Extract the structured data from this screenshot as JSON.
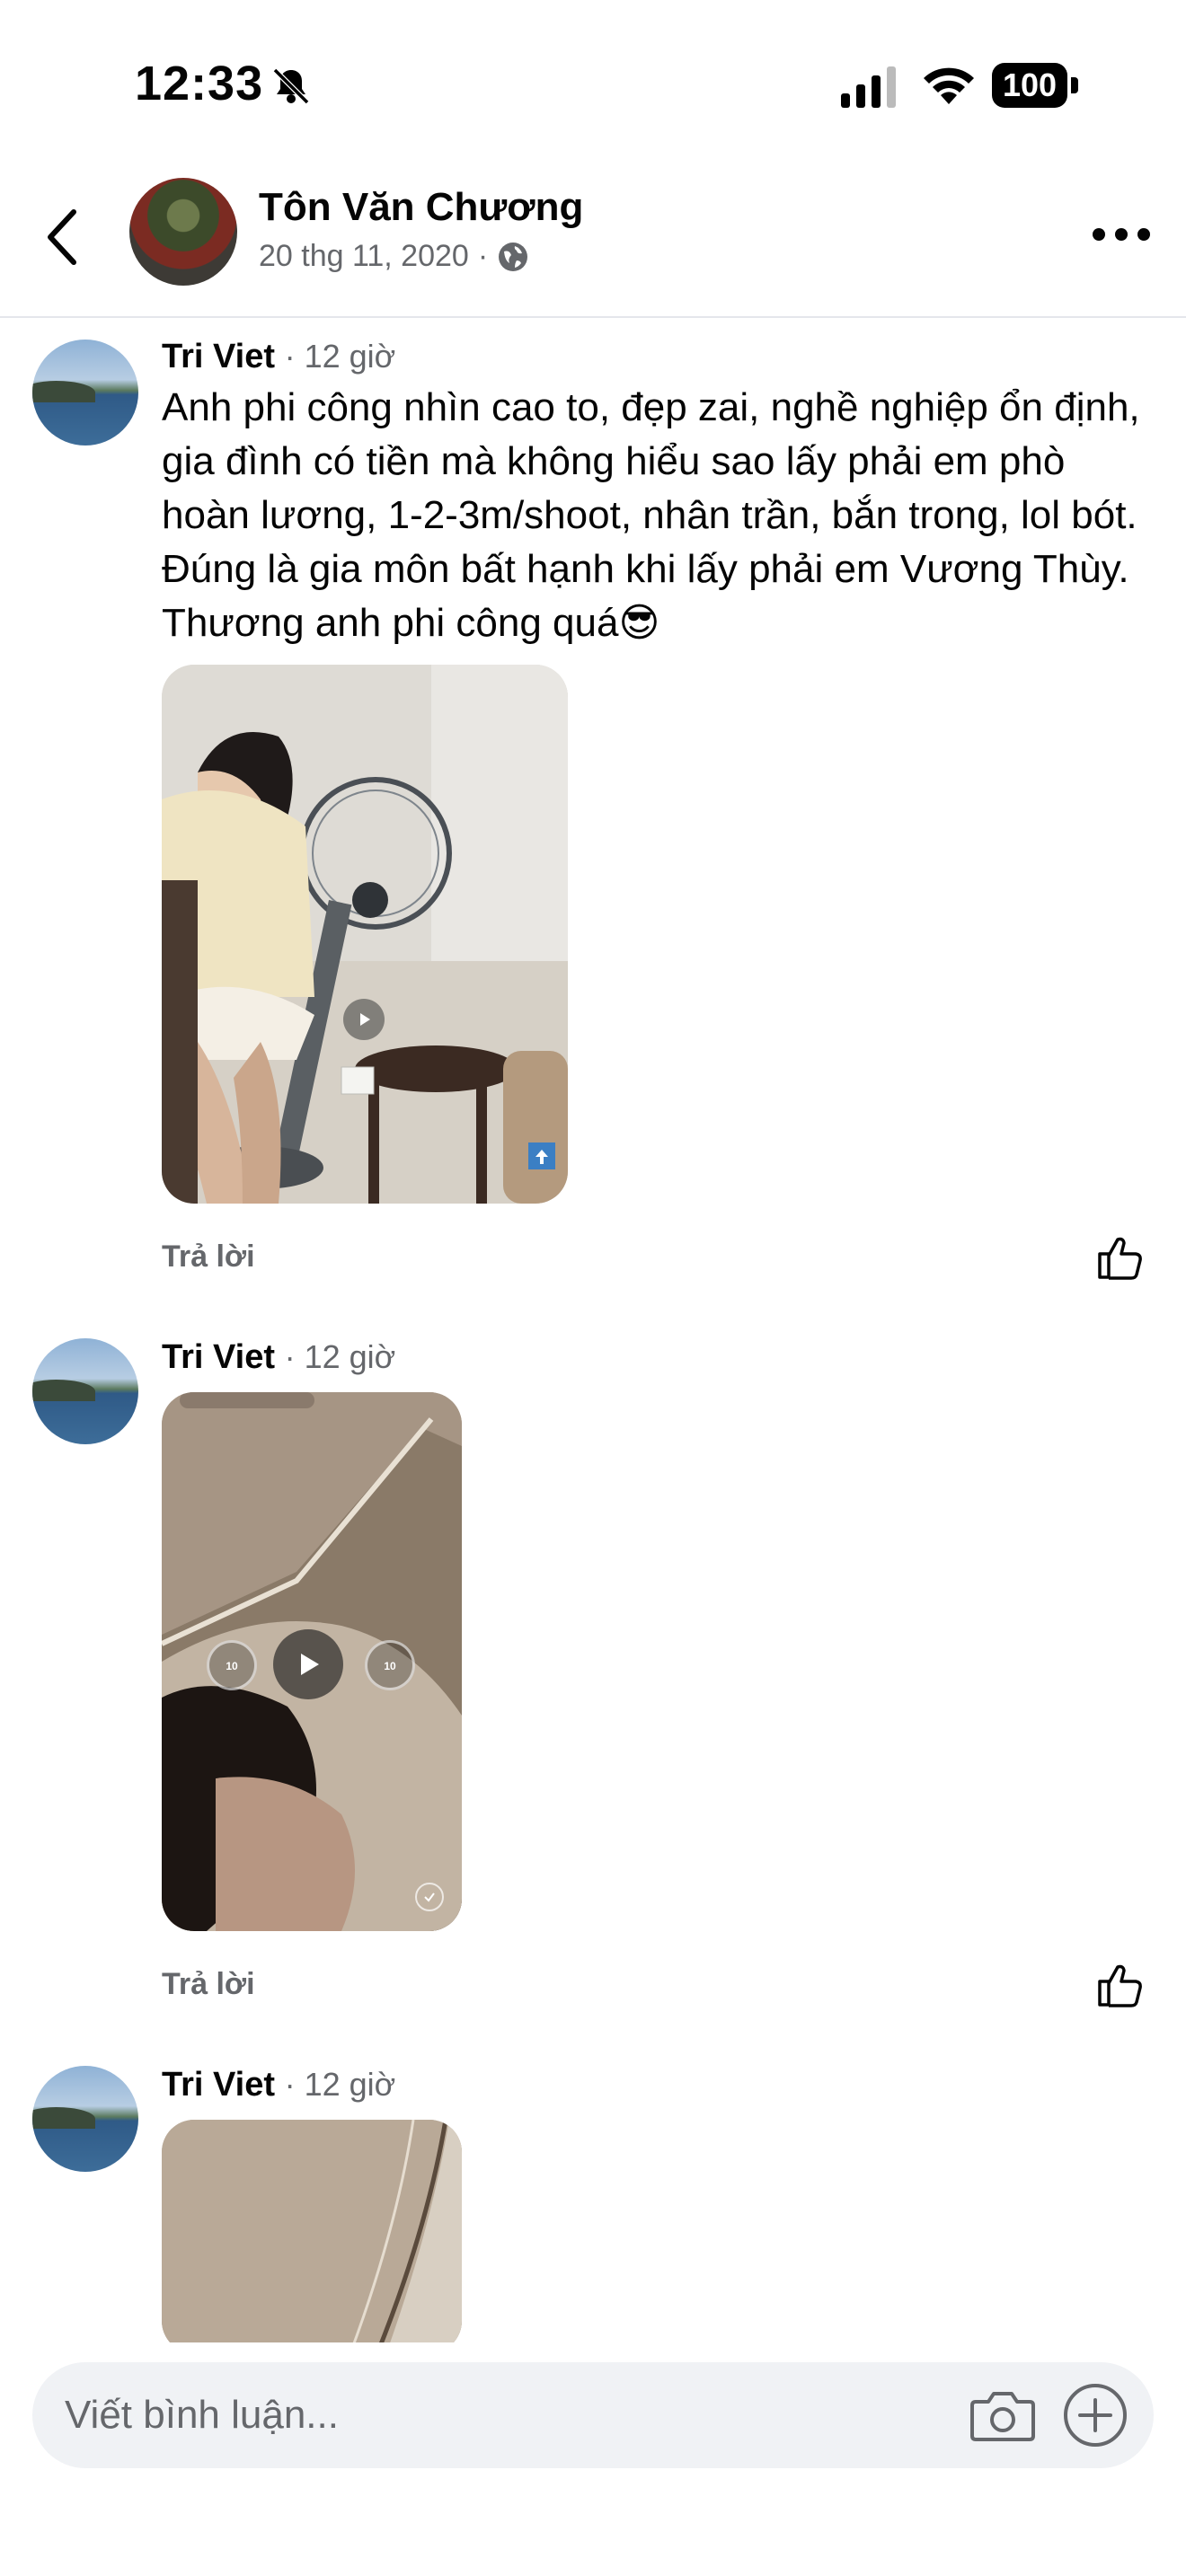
{
  "status_bar": {
    "time": "12:33",
    "battery": "100"
  },
  "header": {
    "author": "Tôn Văn Chương",
    "date": "20 thg 11, 2020",
    "separator": "·"
  },
  "comments": [
    {
      "author": "Tri Viet",
      "time": "· 12 giờ",
      "text": "Anh phi công nhìn cao to, đẹp zai, nghề nghiệp ổn định, gia đình có tiền mà không hiểu sao lấy phải em phò hoàn lương, 1-2-3m/shoot, nhân trần, bắn trong, lol bót. Đúng là gia môn bất hạnh khi lấy phải em Vương Thùy. Thương anh phi công quá😎",
      "reply": "Trả lời"
    },
    {
      "author": "Tri Viet",
      "time": "· 12 giờ",
      "reply": "Trả lời"
    },
    {
      "author": "Tri Viet",
      "time": "· 12 giờ"
    }
  ],
  "composer": {
    "placeholder": "Viết bình luận..."
  }
}
